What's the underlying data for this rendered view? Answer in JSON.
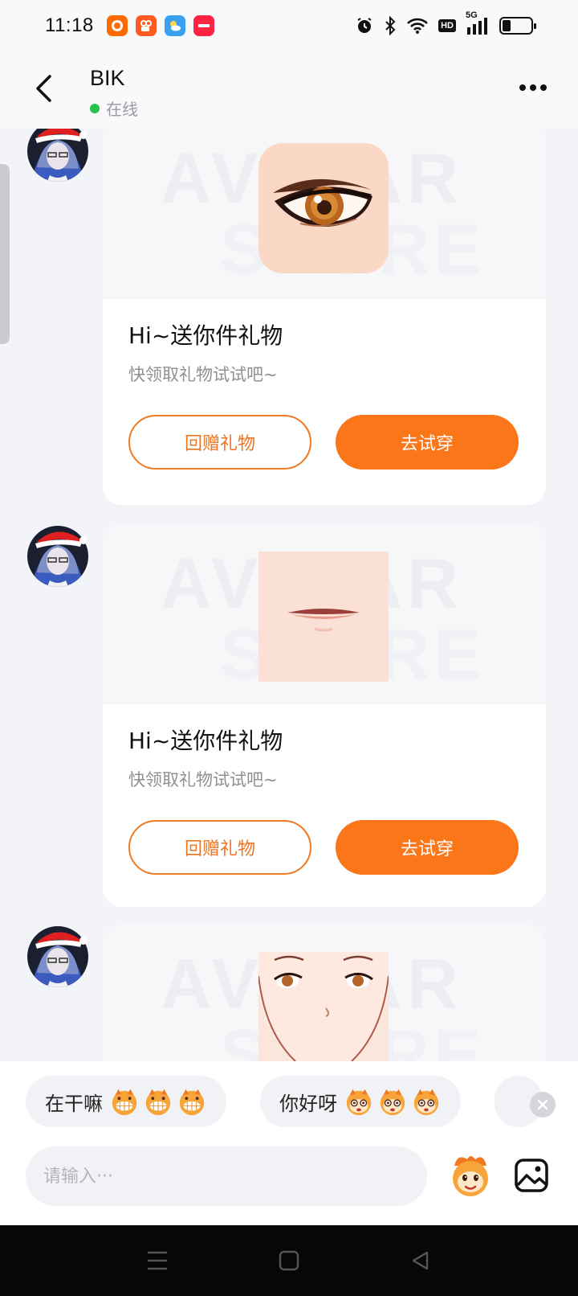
{
  "status_bar": {
    "time": "11:18",
    "hd_label": "HD",
    "network_label": "5G",
    "battery_level": 0.3,
    "apps": [
      {
        "name": "taobao-app-icon",
        "color": "#ff6a00"
      },
      {
        "name": "kuaishou-app-icon",
        "color": "#ff5a1f"
      },
      {
        "name": "weather-app-icon",
        "color": "#3aa0f0"
      },
      {
        "name": "xiaohongshu-app-icon",
        "color": "#ff2442"
      }
    ]
  },
  "header": {
    "title": "BIK",
    "status": "在线"
  },
  "messages": [
    {
      "title": "Hi~送你件礼物",
      "subtitle": "快领取礼物试试吧~",
      "return_gift_label": "回赠礼物",
      "try_on_label": "去试穿",
      "item": "eye"
    },
    {
      "title": "Hi~送你件礼物",
      "subtitle": "快领取礼物试试吧~",
      "return_gift_label": "回赠礼物",
      "try_on_label": "去试穿",
      "item": "lips"
    },
    {
      "item": "face"
    }
  ],
  "watermark": {
    "line1": "AVATAR",
    "line2": "STORE"
  },
  "quick_replies": [
    {
      "text": "在干嘛"
    },
    {
      "text": "你好呀"
    }
  ],
  "input": {
    "placeholder": "请输入···"
  },
  "colors": {
    "accent": "#fb7619",
    "online": "#27c24c"
  }
}
